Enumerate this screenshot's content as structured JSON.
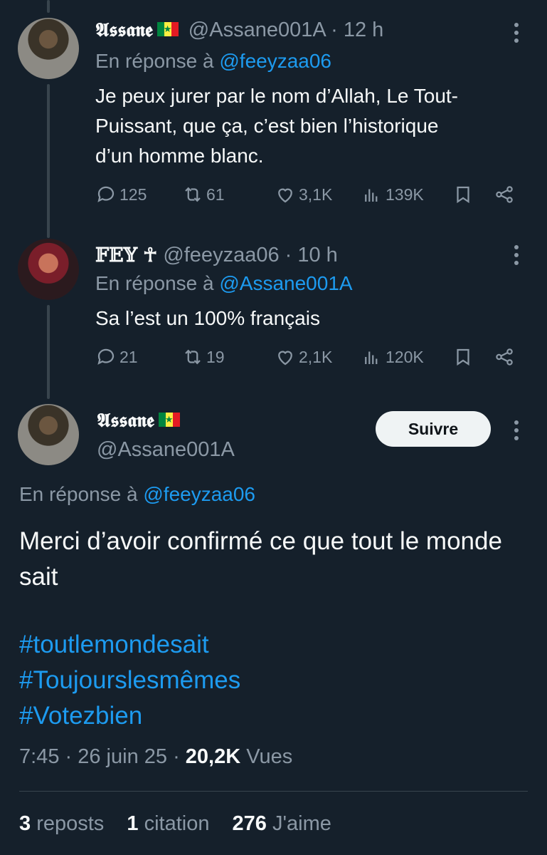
{
  "tweet1": {
    "name": "𝕬𝖘𝖘𝖆𝖓𝖊",
    "handle": "@Assane001A",
    "time": "· 12 h",
    "reply_prefix": "En réponse à",
    "reply_to": "@feeyzaa06",
    "text": "Je peux jurer par le nom d’Allah, Le Tout-Puissant, que ça, c’est bien l’historique d’un homme blanc.",
    "replies": "125",
    "reposts": "61",
    "likes": "3,1K",
    "views": "139K"
  },
  "tweet2": {
    "name": "𝔽𝔼𝕐",
    "name_suffix": "☥",
    "handle": "@feeyzaa06",
    "time": "· 10 h",
    "reply_prefix": "En réponse à",
    "reply_to": "@Assane001A",
    "text": "Sa l’est un 100% français",
    "replies": "21",
    "reposts": "19",
    "likes": "2,1K",
    "views": "120K"
  },
  "main": {
    "name": "𝕬𝖘𝖘𝖆𝖓𝖊",
    "handle": "@Assane001A",
    "follow_label": "Suivre",
    "reply_prefix": "En réponse à",
    "reply_to": "@feeyzaa06",
    "text": "Merci d’avoir confirmé ce que tout le monde sait",
    "hashtags": [
      "#toutlemondesait",
      "#Toujourslesmêmes",
      "#Votezbien"
    ],
    "time": "7:45",
    "date": "26 juin 25",
    "views_count": "20,2K",
    "views_label": "Vues",
    "reposts_count": "3",
    "reposts_label": "reposts",
    "quotes_count": "1",
    "quotes_label": "citation",
    "likes_count": "276",
    "likes_label": "J'aime"
  },
  "icons": [
    "reply-icon",
    "repost-icon",
    "like-icon",
    "views-icon",
    "bookmark-icon",
    "share-icon",
    "more-icon"
  ],
  "colors": {
    "background": "#15202b",
    "link": "#1d9bf0",
    "muted": "#8b98a5",
    "text": "#f7f9f9"
  }
}
